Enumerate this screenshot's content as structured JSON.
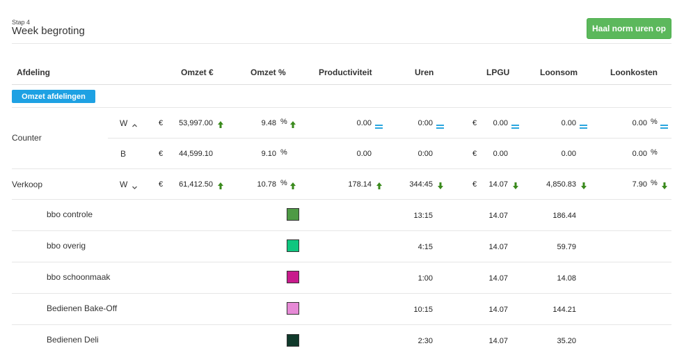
{
  "header": {
    "step": "Stap 4",
    "title": "Week begroting",
    "norm_button": "Haal norm uren op"
  },
  "columns": [
    "Afdeling",
    "Omzet €",
    "Omzet %",
    "Productiviteit",
    "Uren",
    "LPGU",
    "Loonsom",
    "Loonkosten"
  ],
  "omzet_button": "Omzet afdelingen",
  "symbols": {
    "euro": "€",
    "percent": "%"
  },
  "colors": {
    "up": "#3a8a1c",
    "equal": "#2aa6df",
    "down": "#3a8a1c",
    "button_green": "#5cb85c",
    "button_blue": "#1ea1e3"
  },
  "counter": {
    "name": "Counter",
    "week": {
      "code": "W",
      "omzet": "53,997.00",
      "omzet_pct": "9.48",
      "productiviteit": "0.00",
      "uren": "0:00",
      "lpgu": "0.00",
      "loonsom": "0.00",
      "loonkosten": "0.00"
    },
    "budget": {
      "code": "B",
      "omzet": "44,599.10",
      "omzet_pct": "9.10",
      "productiviteit": "0.00",
      "uren": "0:00",
      "lpgu": "0.00",
      "loonsom": "0.00",
      "loonkosten": "0.00"
    }
  },
  "verkoop": {
    "name": "Verkoop",
    "week": {
      "code": "W",
      "omzet": "61,412.50",
      "omzet_pct": "10.78",
      "productiviteit": "178.14",
      "uren": "344:45",
      "lpgu": "14.07",
      "loonsom": "4,850.83",
      "loonkosten": "7.90"
    }
  },
  "sub_rows": [
    {
      "name": "bbo controle",
      "color": "#4e9a45",
      "uren": "13:15",
      "lpgu": "14.07",
      "loonsom": "186.44"
    },
    {
      "name": "bbo overig",
      "color": "#0fc67f",
      "uren": "4:15",
      "lpgu": "14.07",
      "loonsom": "59.79"
    },
    {
      "name": "bbo schoonmaak",
      "color": "#c81b8c",
      "uren": "1:00",
      "lpgu": "14.07",
      "loonsom": "14.08"
    },
    {
      "name": "Bedienen Bake-Off",
      "color": "#e68ad6",
      "uren": "10:15",
      "lpgu": "14.07",
      "loonsom": "144.21"
    },
    {
      "name": "Bedienen Deli",
      "color": "#103a2b",
      "uren": "2:30",
      "lpgu": "14.07",
      "loonsom": "35.20"
    }
  ]
}
